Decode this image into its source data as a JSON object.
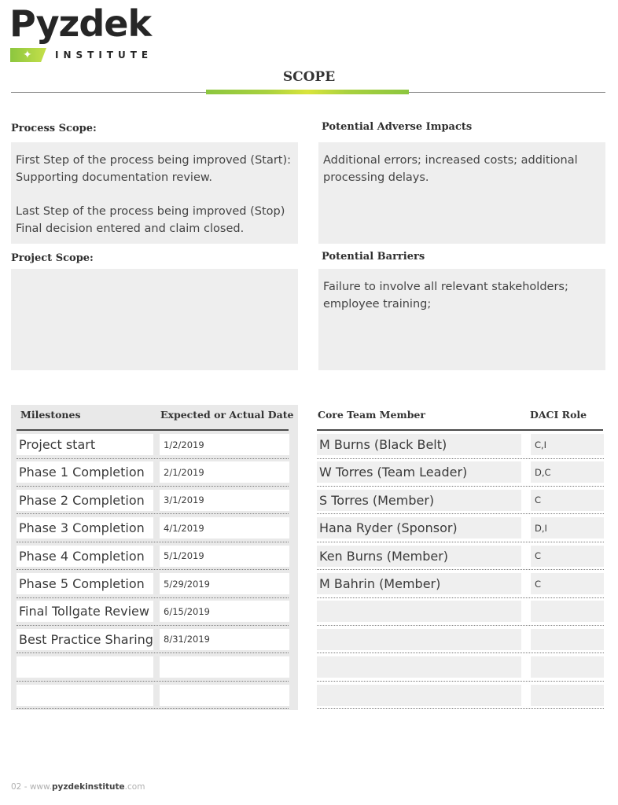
{
  "logo": {
    "word": "Pyzdek",
    "sub": "INSTITUTE",
    "star_icon": "✦"
  },
  "colors": {
    "accent_green": "#8cc63f",
    "accent_yellow": "#d9e43c",
    "box_gray": "#eeeeee"
  },
  "page_title": "SCOPE",
  "process_scope": {
    "label": "Process Scope:",
    "paragraphs": [
      "First Step of the process being improved (Start): Supporting documentation review.",
      "Last Step of the process being improved (Stop) Final decision entered and claim closed."
    ]
  },
  "adverse_impacts": {
    "label": "Potential Adverse Impacts",
    "text": "Additional errors; increased costs; additional processing delays."
  },
  "project_scope": {
    "label": "Project Scope:",
    "text": ""
  },
  "barriers": {
    "label": "Potential Barriers",
    "text": "Failure to involve all relevant stakeholders; employee training;"
  },
  "milestones": {
    "headers": [
      "Milestones",
      "Expected or Actual Date"
    ],
    "rows": [
      {
        "name": "Project start",
        "date": "1/2/2019"
      },
      {
        "name": "Phase 1 Completion",
        "date": "2/1/2019"
      },
      {
        "name": "Phase 2 Completion",
        "date": "3/1/2019"
      },
      {
        "name": "Phase 3 Completion",
        "date": "4/1/2019"
      },
      {
        "name": "Phase 4 Completion",
        "date": "5/1/2019"
      },
      {
        "name": "Phase 5 Completion",
        "date": "5/29/2019"
      },
      {
        "name": "Final Tollgate Review",
        "date": "6/15/2019"
      },
      {
        "name": "Best Practice Sharing",
        "date": "8/31/2019"
      },
      {
        "name": "",
        "date": ""
      },
      {
        "name": "",
        "date": ""
      }
    ]
  },
  "team": {
    "headers": [
      "Core Team Member",
      "DACI Role"
    ],
    "rows": [
      {
        "member": "M Burns (Black Belt)",
        "role": "C,I"
      },
      {
        "member": "W Torres (Team Leader)",
        "role": "D,C"
      },
      {
        "member": "S Torres (Member)",
        "role": "C"
      },
      {
        "member": "Hana Ryder (Sponsor)",
        "role": "D,I"
      },
      {
        "member": "Ken Burns (Member)",
        "role": "C"
      },
      {
        "member": "M Bahrin (Member)",
        "role": "C"
      },
      {
        "member": "",
        "role": ""
      },
      {
        "member": "",
        "role": ""
      },
      {
        "member": "",
        "role": ""
      },
      {
        "member": "",
        "role": ""
      }
    ]
  },
  "footer": {
    "page": "02",
    "sep": " - ",
    "url_prefix": "www.",
    "url_main": "pyzdekinstitute",
    "url_suffix": ".com"
  }
}
